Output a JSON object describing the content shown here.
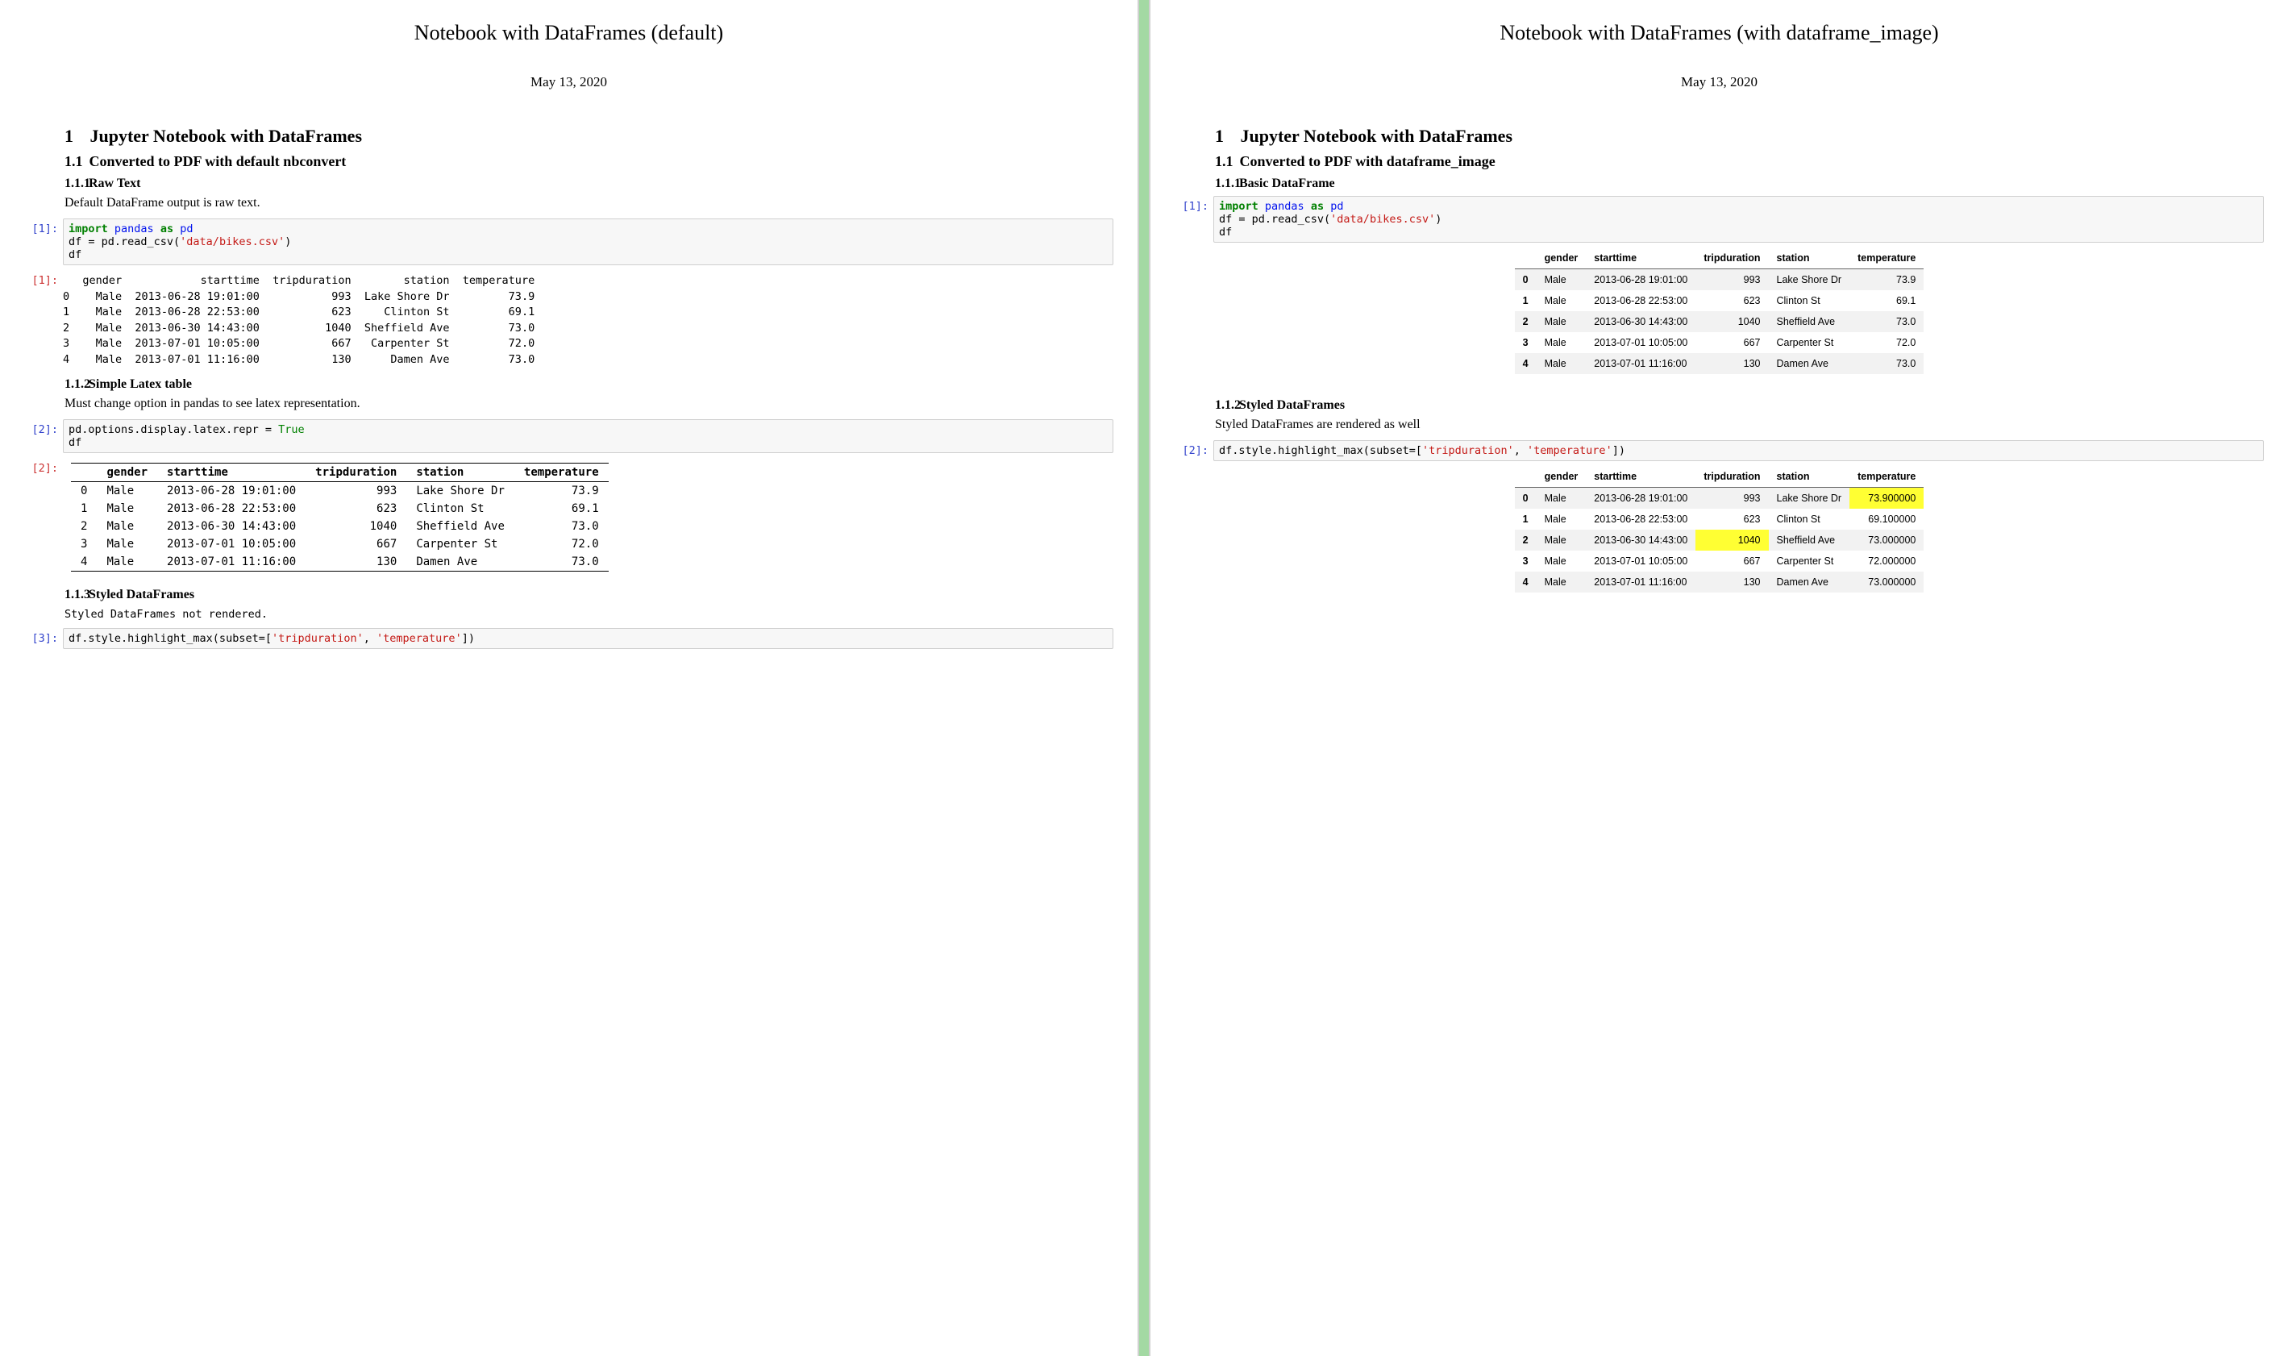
{
  "left": {
    "title": "Notebook with DataFrames (default)",
    "date": "May 13, 2020",
    "h1_num": "1",
    "h1": "Jupyter Notebook with DataFrames",
    "h2_num": "1.1",
    "h2": "Converted to PDF with default nbconvert",
    "s1_num": "1.1.1",
    "s1": "Raw Text",
    "s1_text": "Default DataFrame output is raw text.",
    "cell1_prompt": "[1]:",
    "cell1_code_plain": "import pandas as pd\ndf = pd.read_csv('data/bikes.csv')\ndf",
    "out1_prompt": "[1]:",
    "out1_header": "   gender            starttime  tripduration        station  temperature",
    "out1_rows": [
      "0    Male  2013-06-28 19:01:00           993  Lake Shore Dr         73.9",
      "1    Male  2013-06-28 22:53:00           623     Clinton St         69.1",
      "2    Male  2013-06-30 14:43:00          1040  Sheffield Ave         73.0",
      "3    Male  2013-07-01 10:05:00           667   Carpenter St         72.0",
      "4    Male  2013-07-01 11:16:00           130      Damen Ave         73.0"
    ],
    "s2_num": "1.1.2",
    "s2": "Simple Latex table",
    "s2_text": "Must change option in pandas to see latex representation.",
    "cell2_prompt": "[2]:",
    "cell2_code_plain": "pd.options.display.latex.repr = True\ndf",
    "out2_prompt": "[2]:",
    "latex_cols": [
      "",
      "gender",
      "starttime",
      "tripduration",
      "station",
      "temperature"
    ],
    "latex_rows": [
      [
        "0",
        "Male",
        "2013-06-28 19:01:00",
        "993",
        "Lake Shore Dr",
        "73.9"
      ],
      [
        "1",
        "Male",
        "2013-06-28 22:53:00",
        "623",
        "Clinton St",
        "69.1"
      ],
      [
        "2",
        "Male",
        "2013-06-30 14:43:00",
        "1040",
        "Sheffield Ave",
        "73.0"
      ],
      [
        "3",
        "Male",
        "2013-07-01 10:05:00",
        "667",
        "Carpenter St",
        "72.0"
      ],
      [
        "4",
        "Male",
        "2013-07-01 11:16:00",
        "130",
        "Damen Ave",
        "73.0"
      ]
    ],
    "s3_num": "1.1.3",
    "s3": "Styled DataFrames",
    "s3_text": "Styled DataFrames not rendered.",
    "cell3_prompt": "[3]:",
    "cell3_code_plain": "df.style.highlight_max(subset=['tripduration', 'temperature'])"
  },
  "right": {
    "title": "Notebook with DataFrames (with dataframe_image)",
    "date": "May 13, 2020",
    "h1_num": "1",
    "h1": "Jupyter Notebook with DataFrames",
    "h2_num": "1.1",
    "h2": "Converted to PDF with dataframe_image",
    "s1_num": "1.1.1",
    "s1": "Basic DataFrame",
    "cell1_prompt": "[1]:",
    "cell1_code_plain": "import pandas as pd\ndf = pd.read_csv('data/bikes.csv')\ndf",
    "table1_cols": [
      "",
      "gender",
      "starttime",
      "tripduration",
      "station",
      "temperature"
    ],
    "table1_rows": [
      [
        "0",
        "Male",
        "2013-06-28 19:01:00",
        "993",
        "Lake Shore Dr",
        "73.9"
      ],
      [
        "1",
        "Male",
        "2013-06-28 22:53:00",
        "623",
        "Clinton St",
        "69.1"
      ],
      [
        "2",
        "Male",
        "2013-06-30 14:43:00",
        "1040",
        "Sheffield Ave",
        "73.0"
      ],
      [
        "3",
        "Male",
        "2013-07-01 10:05:00",
        "667",
        "Carpenter St",
        "72.0"
      ],
      [
        "4",
        "Male",
        "2013-07-01 11:16:00",
        "130",
        "Damen Ave",
        "73.0"
      ]
    ],
    "s2_num": "1.1.2",
    "s2": "Styled DataFrames",
    "s2_text": "Styled DataFrames are rendered as well",
    "cell2_prompt": "[2]:",
    "cell2_code_plain": "df.style.highlight_max(subset=['tripduration', 'temperature'])",
    "table2_cols": [
      "",
      "gender",
      "starttime",
      "tripduration",
      "station",
      "temperature"
    ],
    "table2_rows": [
      {
        "cells": [
          "0",
          "Male",
          "2013-06-28 19:01:00",
          "993",
          "Lake Shore Dr",
          "73.900000"
        ],
        "hl": [
          5
        ]
      },
      {
        "cells": [
          "1",
          "Male",
          "2013-06-28 22:53:00",
          "623",
          "Clinton St",
          "69.100000"
        ],
        "hl": []
      },
      {
        "cells": [
          "2",
          "Male",
          "2013-06-30 14:43:00",
          "1040",
          "Sheffield Ave",
          "73.000000"
        ],
        "hl": [
          3
        ]
      },
      {
        "cells": [
          "3",
          "Male",
          "2013-07-01 10:05:00",
          "667",
          "Carpenter St",
          "72.000000"
        ],
        "hl": []
      },
      {
        "cells": [
          "4",
          "Male",
          "2013-07-01 11:16:00",
          "130",
          "Damen Ave",
          "73.000000"
        ],
        "hl": []
      }
    ]
  }
}
